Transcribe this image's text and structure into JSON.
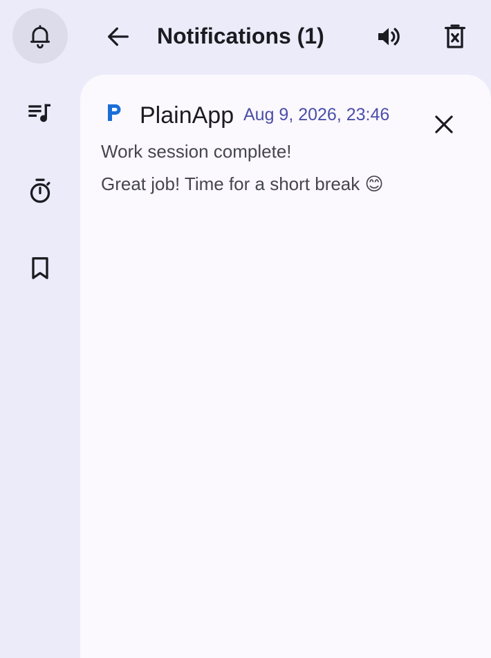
{
  "rail": {
    "items": [
      {
        "name": "notifications",
        "icon": "bell-icon",
        "active": true
      },
      {
        "name": "playlist",
        "icon": "playlist-music-icon",
        "active": false
      },
      {
        "name": "timer",
        "icon": "timer-icon",
        "active": false
      },
      {
        "name": "bookmarks",
        "icon": "bookmark-icon",
        "active": false
      }
    ]
  },
  "topbar": {
    "back_icon": "arrow-left-icon",
    "title": "Notifications (1)",
    "sound_icon": "volume-icon",
    "clear_all_icon": "delete-all-icon"
  },
  "notifications": [
    {
      "app_name": "PlainApp",
      "app_icon": "plainapp-logo-icon",
      "time": "Aug 9, 2026, 23:46",
      "title": "Work session complete!",
      "body": "Great job! Time for a short break 😊",
      "dismiss_icon": "close-icon"
    }
  ],
  "colors": {
    "background": "#ecebf9",
    "surface": "#fbf8fe",
    "active_rail": "#dddceb",
    "accent_time": "#4a4fa8",
    "logo_blue": "#1a6ed8"
  }
}
